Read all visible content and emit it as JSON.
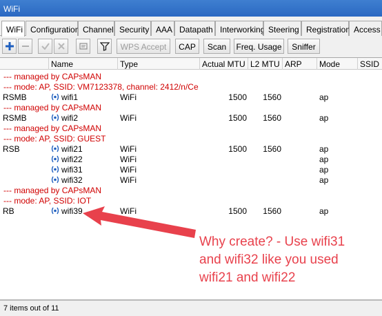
{
  "window": {
    "title": "WiFi"
  },
  "tabs": [
    {
      "label": "WiFi",
      "active": true
    },
    {
      "label": "Configuration"
    },
    {
      "label": "Channel"
    },
    {
      "label": "Security"
    },
    {
      "label": "AAA"
    },
    {
      "label": "Datapath"
    },
    {
      "label": "Interworking"
    },
    {
      "label": "Steering"
    },
    {
      "label": "Registration"
    },
    {
      "label": "Access L"
    }
  ],
  "toolbar": {
    "icons": [
      "add-icon",
      "remove-icon",
      "enable-icon",
      "disable-icon",
      "comment-icon",
      "filter-icon"
    ],
    "wps_accept": "WPS Accept",
    "cap": "CAP",
    "scan": "Scan",
    "freq_usage": "Freq. Usage",
    "sniffer": "Sniffer"
  },
  "table": {
    "headers": [
      "Name",
      "Type",
      "Actual MTU",
      "L2 MTU",
      "ARP",
      "Mode",
      "SSID"
    ],
    "rows": [
      {
        "kind": "comment",
        "text": "--- managed by CAPsMAN"
      },
      {
        "kind": "comment",
        "text": "--- mode: AP, SSID: VM7123378, channel: 2412/n/Ce"
      },
      {
        "kind": "data",
        "flag": "RSMB",
        "name": "wifi1",
        "type": "WiFi",
        "mtu": "1500",
        "l2mtu": "1560",
        "arp": "",
        "mode": "ap"
      },
      {
        "kind": "comment",
        "text": "--- managed by CAPsMAN"
      },
      {
        "kind": "data",
        "flag": "RSMB",
        "name": "wifi2",
        "type": "WiFi",
        "mtu": "1500",
        "l2mtu": "1560",
        "arp": "",
        "mode": "ap"
      },
      {
        "kind": "comment",
        "text": "--- managed by CAPsMAN"
      },
      {
        "kind": "comment",
        "text": "--- mode: AP, SSID: GUEST"
      },
      {
        "kind": "data",
        "flag": "RSB",
        "name": "wifi21",
        "type": "WiFi",
        "mtu": "1500",
        "l2mtu": "1560",
        "arp": "",
        "mode": "ap"
      },
      {
        "kind": "data",
        "flag": "",
        "name": "wifi22",
        "type": "WiFi",
        "mtu": "",
        "l2mtu": "",
        "arp": "",
        "mode": "ap"
      },
      {
        "kind": "data",
        "flag": "",
        "name": "wifi31",
        "type": "WiFi",
        "mtu": "",
        "l2mtu": "",
        "arp": "",
        "mode": "ap"
      },
      {
        "kind": "data",
        "flag": "",
        "name": "wifi32",
        "type": "WiFi",
        "mtu": "",
        "l2mtu": "",
        "arp": "",
        "mode": "ap"
      },
      {
        "kind": "comment",
        "text": "--- managed by CAPsMAN"
      },
      {
        "kind": "comment",
        "text": "--- mode: AP, SSID: IOT"
      },
      {
        "kind": "data",
        "flag": "RB",
        "name": "wifi39",
        "type": "WiFi",
        "mtu": "1500",
        "l2mtu": "1560",
        "arp": "",
        "mode": "ap"
      }
    ]
  },
  "annotation": {
    "lines": [
      "Why create? - Use wifi31",
      "and wifi32 like you used",
      "wifi21 and wifi22"
    ],
    "color": "#e8414c"
  },
  "status": {
    "text": "7 items out of 11"
  },
  "colors": {
    "comment": "#d00000",
    "titlebar": "#2f6fc9",
    "icon_blue": "#1f5fbf"
  }
}
